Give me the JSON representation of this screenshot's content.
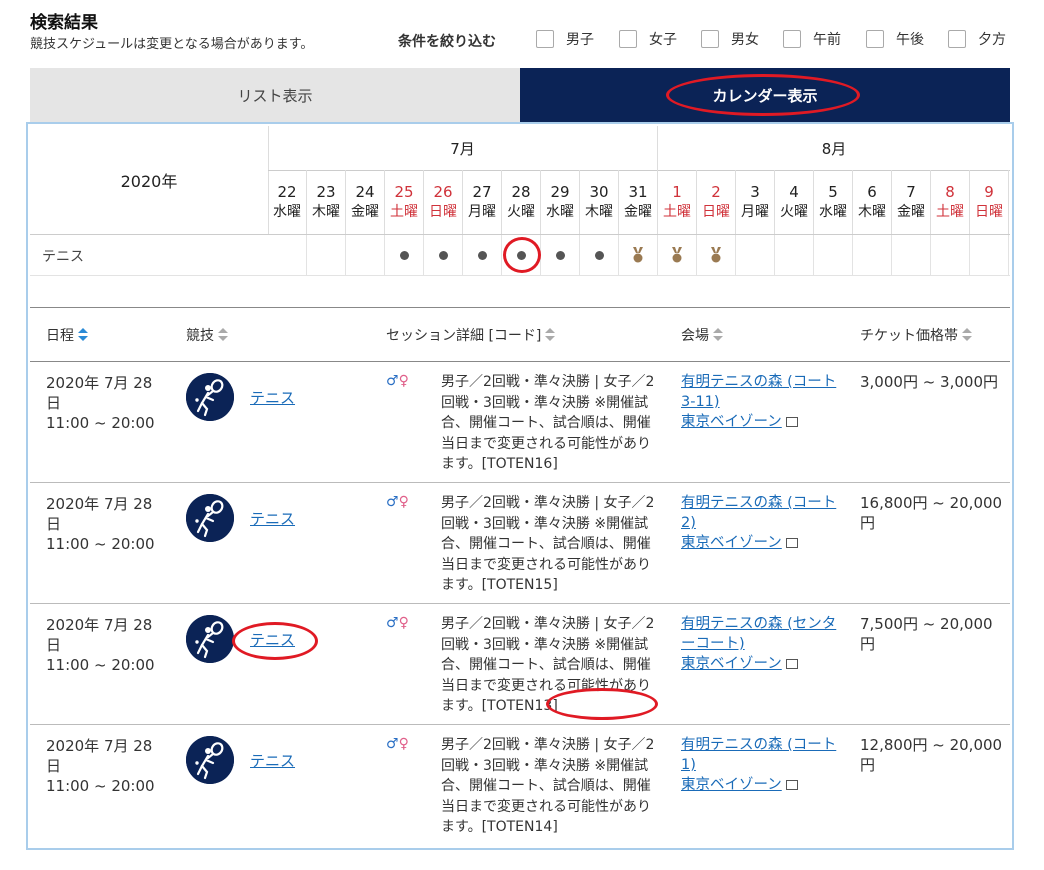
{
  "header": {
    "title": "検索結果",
    "subtitle": "競技スケジュールは変更となる場合があります。",
    "filter_label": "条件を絞り込む",
    "filters": [
      "男子",
      "女子",
      "男女",
      "午前",
      "午後",
      "夕方"
    ]
  },
  "tabs": {
    "list": "リスト表示",
    "calendar": "カレンダー表示",
    "active": "calendar"
  },
  "calendar": {
    "year": "2020年",
    "months": [
      "7月",
      "8月"
    ],
    "days": [
      {
        "d": "22",
        "w": "水曜",
        "holiday": false
      },
      {
        "d": "23",
        "w": "木曜",
        "holiday": false
      },
      {
        "d": "24",
        "w": "金曜",
        "holiday": false
      },
      {
        "d": "25",
        "w": "土曜",
        "holiday": true
      },
      {
        "d": "26",
        "w": "日曜",
        "holiday": true
      },
      {
        "d": "27",
        "w": "月曜",
        "holiday": false
      },
      {
        "d": "28",
        "w": "火曜",
        "holiday": false
      },
      {
        "d": "29",
        "w": "水曜",
        "holiday": false
      },
      {
        "d": "30",
        "w": "木曜",
        "holiday": false
      },
      {
        "d": "31",
        "w": "金曜",
        "holiday": false
      },
      {
        "d": "1",
        "w": "土曜",
        "holiday": true
      },
      {
        "d": "2",
        "w": "日曜",
        "holiday": true
      },
      {
        "d": "3",
        "w": "月曜",
        "holiday": false
      },
      {
        "d": "4",
        "w": "火曜",
        "holiday": false
      },
      {
        "d": "5",
        "w": "水曜",
        "holiday": false
      },
      {
        "d": "6",
        "w": "木曜",
        "holiday": false
      },
      {
        "d": "7",
        "w": "金曜",
        "holiday": false
      },
      {
        "d": "8",
        "w": "土曜",
        "holiday": true
      },
      {
        "d": "9",
        "w": "日曜",
        "holiday": true
      }
    ],
    "sport": "テニス",
    "marks": [
      "",
      "",
      "",
      "dot",
      "dot",
      "dot",
      "dot",
      "dot",
      "dot",
      "medal",
      "medal",
      "medal",
      "",
      "",
      "",
      "",
      "",
      "",
      ""
    ]
  },
  "table": {
    "headers": [
      "日程",
      "競技",
      "セッション詳細 [コード]",
      "会場",
      "チケット価格帯"
    ],
    "rows": [
      {
        "date": "2020年 7月 28日",
        "time": "11:00 ~ 20:00",
        "sport": "テニス",
        "session": "男子／2回戦・準々決勝 | 女子／2回戦・3回戦・準々決勝 ※開催試合、開催コート、試合順は、開催当日まで変更される可能性があります。[TOTEN16]",
        "venue": "有明テニスの森 (コート3-11)",
        "area": "東京ベイゾーン",
        "price": "3,000円 ~ 3,000円"
      },
      {
        "date": "2020年 7月 28日",
        "time": "11:00 ~ 20:00",
        "sport": "テニス",
        "session": "男子／2回戦・準々決勝 | 女子／2回戦・3回戦・準々決勝 ※開催試合、開催コート、試合順は、開催当日まで変更される可能性があります。[TOTEN15]",
        "venue": "有明テニスの森 (コート2)",
        "area": "東京ベイゾーン",
        "price": "16,800円 ~ 20,000円"
      },
      {
        "date": "2020年 7月 28日",
        "time": "11:00 ~ 20:00",
        "sport": "テニス",
        "session": "男子／2回戦・準々決勝 | 女子／2回戦・3回戦・準々決勝 ※開催試合、開催コート、試合順は、開催当日まで変更される可能性があります。[TOTEN13]",
        "venue": "有明テニスの森 (センターコート)",
        "area": "東京ベイゾーン",
        "price": "7,500円 ~ 20,000円"
      },
      {
        "date": "2020年 7月 28日",
        "time": "11:00 ~ 20:00",
        "sport": "テニス",
        "session": "男子／2回戦・準々決勝 | 女子／2回戦・3回戦・準々決勝 ※開催試合、開催コート、試合順は、開催当日まで変更される可能性があります。[TOTEN14]",
        "venue": "有明テニスの森 (コート1)",
        "area": "東京ベイゾーン",
        "price": "12,800円 ~ 20,000円"
      }
    ]
  },
  "colors": {
    "navy": "#0b2356",
    "link": "#1a6bb8",
    "holiday": "#d0323a",
    "highlight": "#e01a24",
    "medal": "#9a7a52"
  }
}
